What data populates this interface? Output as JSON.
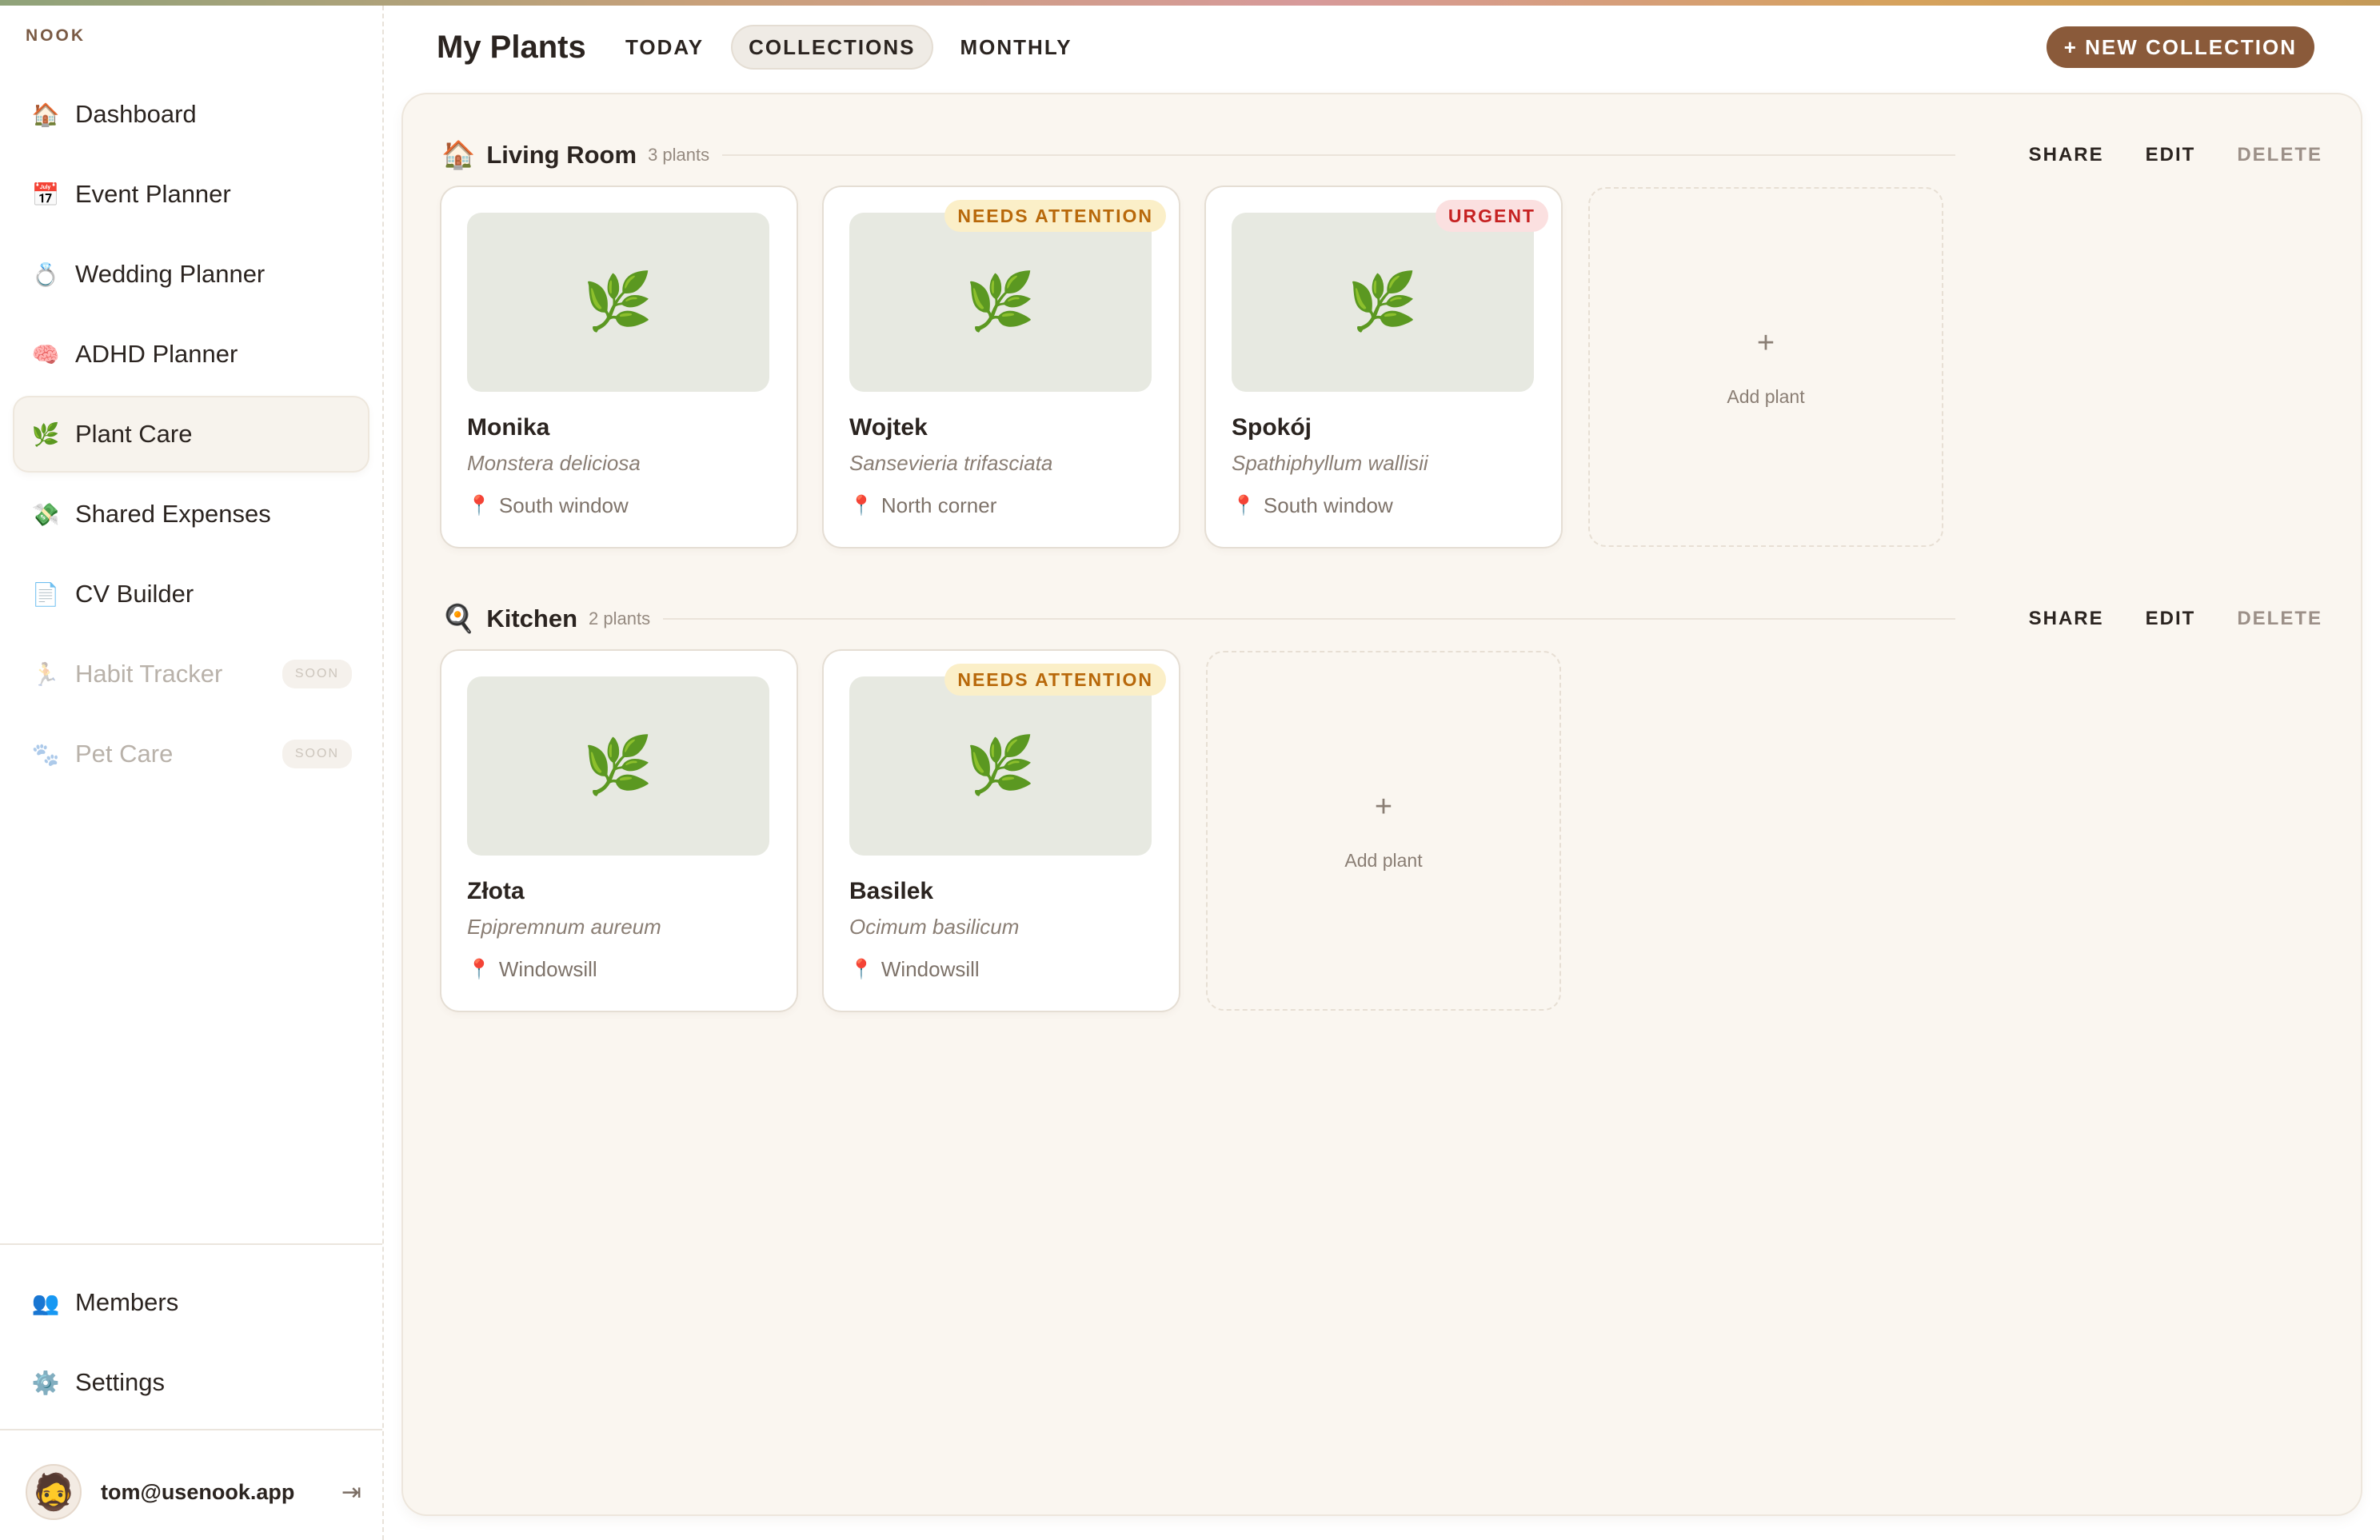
{
  "app": {
    "brand": "NOOK"
  },
  "sidebar": {
    "items": [
      {
        "icon": "🏠",
        "icon_name": "house-icon",
        "label": "Dashboard",
        "state": "normal"
      },
      {
        "icon": "📅",
        "icon_name": "calendar-icon",
        "label": "Event Planner",
        "state": "normal"
      },
      {
        "icon": "💍",
        "icon_name": "ring-icon",
        "label": "Wedding Planner",
        "state": "normal"
      },
      {
        "icon": "🧠",
        "icon_name": "brain-icon",
        "label": "ADHD Planner",
        "state": "normal"
      },
      {
        "icon": "🌿",
        "icon_name": "herb-icon",
        "label": "Plant Care",
        "state": "active"
      },
      {
        "icon": "💸",
        "icon_name": "money-icon",
        "label": "Shared Expenses",
        "state": "normal"
      },
      {
        "icon": "📄",
        "icon_name": "document-icon",
        "label": "CV Builder",
        "state": "normal"
      },
      {
        "icon": "🏃",
        "icon_name": "runner-icon",
        "label": "Habit Tracker",
        "state": "disabled",
        "badge": "SOON"
      },
      {
        "icon": "🐾",
        "icon_name": "paw-icon",
        "label": "Pet Care",
        "state": "disabled",
        "badge": "SOON"
      }
    ],
    "bottom_items": [
      {
        "icon": "👥",
        "icon_name": "members-icon",
        "label": "Members"
      },
      {
        "icon": "⚙️",
        "icon_name": "gear-icon",
        "label": "Settings"
      }
    ],
    "user": {
      "email": "tom@usenook.app",
      "avatar_icon": "🧔",
      "logout_icon": "⇥"
    }
  },
  "header": {
    "title": "My Plants",
    "tabs": [
      {
        "label": "TODAY",
        "active": false
      },
      {
        "label": "COLLECTIONS",
        "active": true
      },
      {
        "label": "MONTHLY",
        "active": false
      }
    ],
    "new_button": "+ NEW COLLECTION"
  },
  "collections": [
    {
      "icon": "🏠",
      "name": "Living Room",
      "count": "3 plants",
      "actions": {
        "share": "SHARE",
        "edit": "EDIT",
        "delete": "DELETE"
      },
      "plants": [
        {
          "name": "Monika",
          "scientific": "Monstera deliciosa",
          "location": "South window",
          "status": ""
        },
        {
          "name": "Wojtek",
          "scientific": "Sansevieria trifasciata",
          "location": "North corner",
          "status": "NEEDS ATTENTION",
          "status_type": "attention"
        },
        {
          "name": "Spokój",
          "scientific": "Spathiphyllum wallisii",
          "location": "South window",
          "status": "URGENT",
          "status_type": "urgent"
        }
      ],
      "add_label": "Add plant"
    },
    {
      "icon": "🍳",
      "name": "Kitchen",
      "count": "2 plants",
      "actions": {
        "share": "SHARE",
        "edit": "EDIT",
        "delete": "DELETE"
      },
      "plants": [
        {
          "name": "Złota",
          "scientific": "Epipremnum aureum",
          "location": "Windowsill",
          "status": ""
        },
        {
          "name": "Basilek",
          "scientific": "Ocimum basilicum",
          "location": "Windowsill",
          "status": "NEEDS ATTENTION",
          "status_type": "attention"
        }
      ],
      "add_label": "Add plant"
    }
  ],
  "icons": {
    "plant": "🌿",
    "pin": "📍",
    "plus": "+"
  },
  "colors": {
    "accent": "#8a5a3a",
    "attention_bg": "#fbefc8",
    "attention_text": "#b8680a",
    "urgent_bg": "#fbe0e0",
    "urgent_text": "#c62222",
    "panel_bg": "#faf6f0"
  }
}
